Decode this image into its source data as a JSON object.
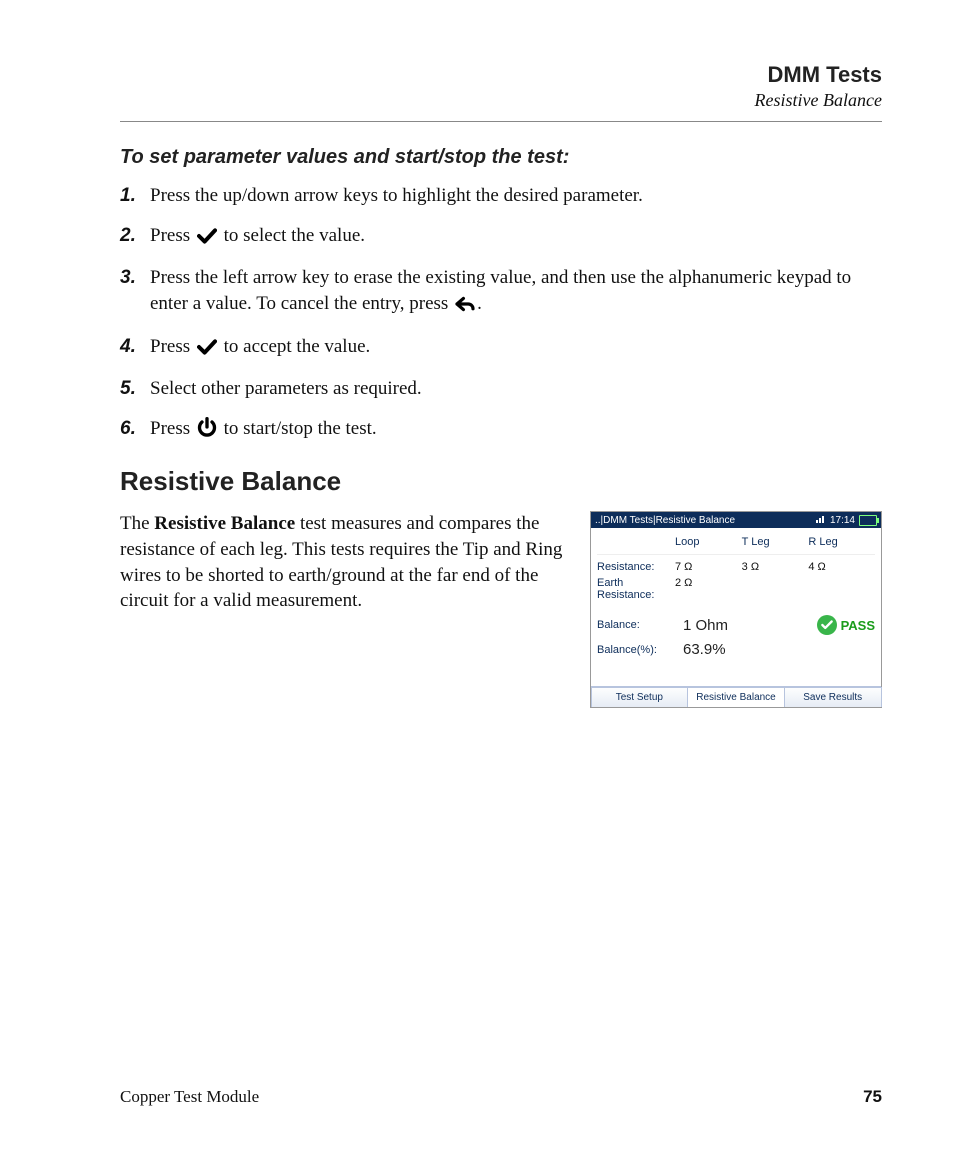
{
  "header": {
    "title": "DMM Tests",
    "subtitle": "Resistive Balance"
  },
  "intro_heading": "To set parameter values and start/stop the test:",
  "steps": [
    {
      "num": "1.",
      "pre": "Press the up/down arrow keys to highlight the desired parameter.",
      "icon": null,
      "post": ""
    },
    {
      "num": "2.",
      "pre": "Press ",
      "icon": "check",
      "post": " to select the value."
    },
    {
      "num": "3.",
      "pre": "Press the left arrow key to erase the existing value, and then use the alphanumeric keypad to enter a value. To cancel the entry, press ",
      "icon": "back",
      "post": "."
    },
    {
      "num": "4.",
      "pre": "Press ",
      "icon": "check",
      "post": " to accept the value."
    },
    {
      "num": "5.",
      "pre": "Select other parameters as required.",
      "icon": null,
      "post": ""
    },
    {
      "num": "6.",
      "pre": "Press ",
      "icon": "power",
      "post": " to start/stop the test."
    }
  ],
  "section_heading": "Resistive Balance",
  "description": {
    "pre": "The ",
    "bold": "Resistive Balance",
    "post": " test measures and compares the resistance of each leg. This tests requires the Tip and Ring wires to be shorted to earth/ground at the far end of the circuit for a valid measurement."
  },
  "device": {
    "breadcrumb": "..|DMM Tests|Resistive Balance",
    "time": "17:14",
    "headers": {
      "c1": "Loop",
      "c2": "T Leg",
      "c3": "R Leg"
    },
    "rows": [
      {
        "label": "Resistance:",
        "c1": "7 Ω",
        "c2": "3 Ω",
        "c3": "4 Ω"
      },
      {
        "label": "Earth Resistance:",
        "c1": "2 Ω",
        "c2": "",
        "c3": ""
      }
    ],
    "balance_label": "Balance:",
    "balance_value": "1 Ohm",
    "pass_text": "PASS",
    "balance_pct_label": "Balance(%):",
    "balance_pct_value": "63.9%",
    "tabs": [
      "Test Setup",
      "Resistive Balance",
      "Save Results"
    ],
    "active_tab": 1
  },
  "footer": {
    "left": "Copper Test Module",
    "right": "75"
  }
}
